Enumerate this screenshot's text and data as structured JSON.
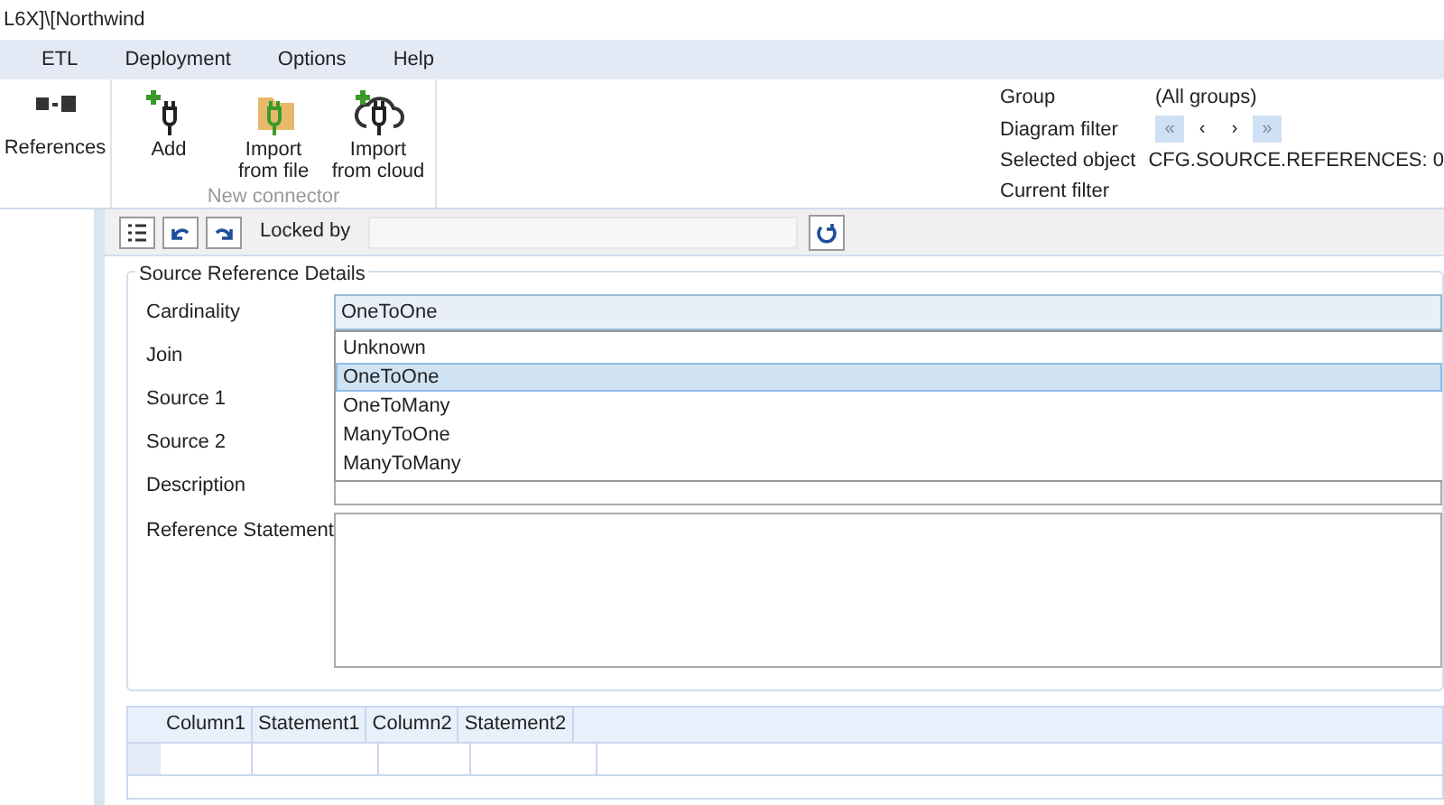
{
  "window": {
    "title": "L6X]\\[Northwind"
  },
  "menu": [
    {
      "label": "ETL"
    },
    {
      "label": "Deployment"
    },
    {
      "label": "Options"
    },
    {
      "label": "Help"
    }
  ],
  "ribbon": {
    "references": {
      "label": "References"
    },
    "connector_group": {
      "label": "New connector",
      "buttons": [
        {
          "kind": "add",
          "label": "Add"
        },
        {
          "kind": "file",
          "label": "Import from file"
        },
        {
          "kind": "cloud",
          "label": "Import from cloud"
        }
      ]
    },
    "info": [
      {
        "label": "Group",
        "value": "(All groups)"
      },
      {
        "label": "Diagram filter",
        "kind": "nav",
        "nav": [
          "«",
          "‹",
          "›",
          "»"
        ]
      },
      {
        "label": "Selected object",
        "value": "CFG.SOURCE.REFERENCES: 0"
      },
      {
        "label": "Current filter"
      }
    ]
  },
  "toolbar": {
    "locked_by_label": "Locked by"
  },
  "details": {
    "title": "Source Reference Details",
    "fields": [
      {
        "label": "Cardinality",
        "value": "OneToOne"
      },
      {
        "label": "Join"
      },
      {
        "label": "Source 1"
      },
      {
        "label": "Source 2"
      },
      {
        "label": "Description"
      },
      {
        "label": "Reference Statement",
        "kind": "multiline"
      }
    ],
    "dropdown": [
      {
        "label": "Unknown",
        "selected": false
      },
      {
        "label": "OneToOne",
        "selected": true
      },
      {
        "label": "OneToMany",
        "selected": false
      },
      {
        "label": "ManyToOne",
        "selected": false
      },
      {
        "label": "ManyToMany",
        "selected": false
      }
    ]
  },
  "table": {
    "columns": [
      "Column1",
      "Statement1",
      "Column2",
      "Statement2"
    ]
  }
}
